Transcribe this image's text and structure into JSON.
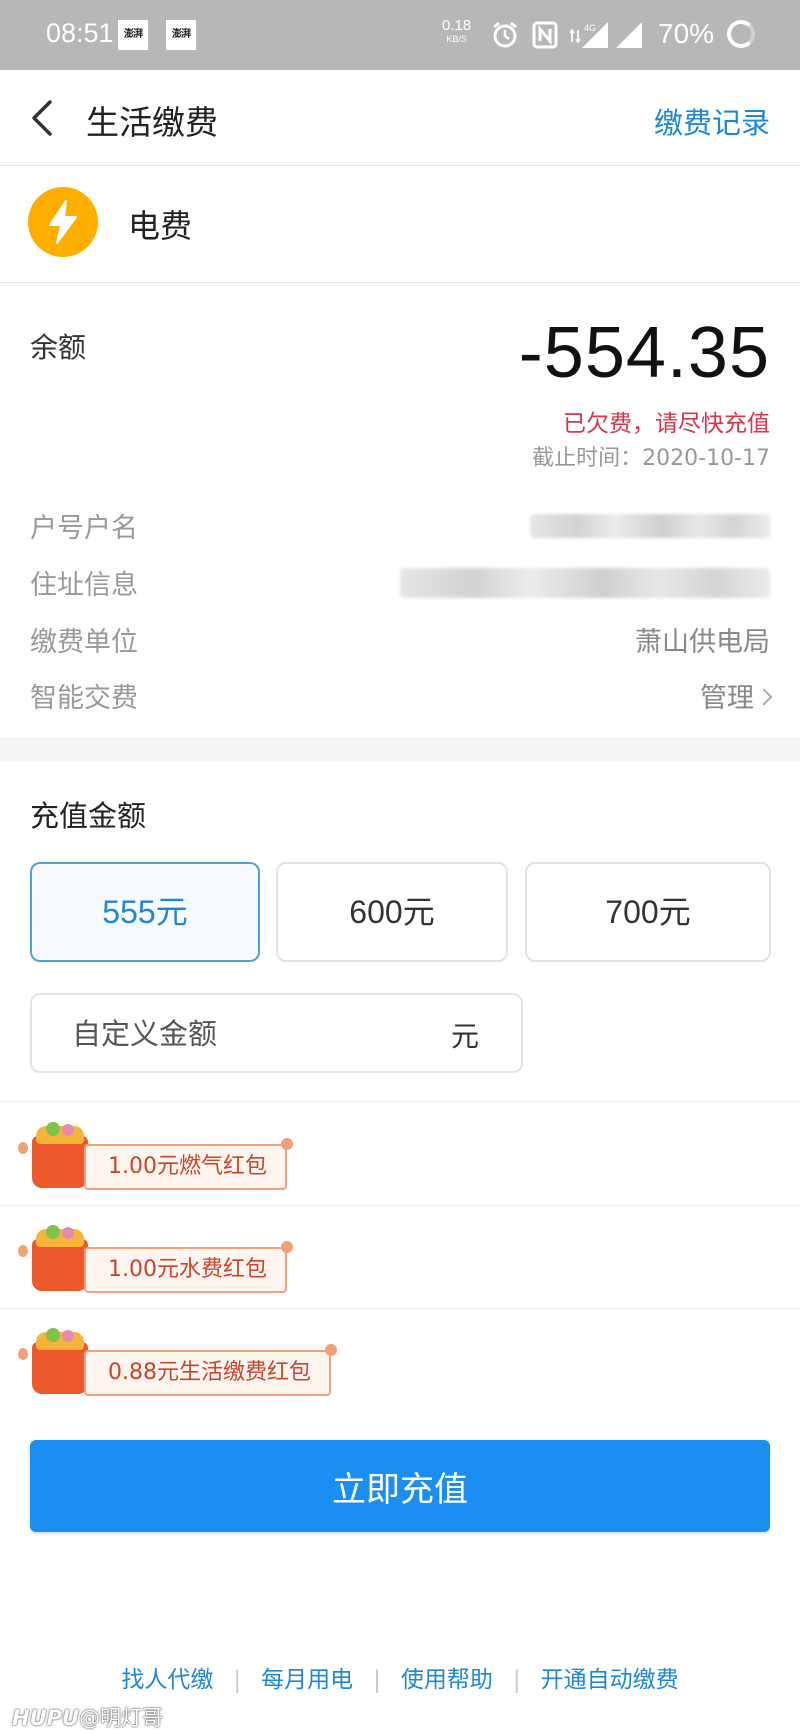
{
  "status_bar": {
    "time": "08:51",
    "app_icon_1": "澎湃",
    "app_icon_2": "澎湃",
    "net_speed": "0.18",
    "net_unit": "KB/S",
    "signal_tag": "4G",
    "battery": "70%",
    "icons": [
      "alarm-icon",
      "nfc-icon",
      "signal-4g-icon",
      "signal-icon",
      "battery-ring-icon"
    ]
  },
  "nav": {
    "title": "生活缴费",
    "record_link": "缴费记录"
  },
  "bill": {
    "icon": "lightning-icon",
    "name": "电费"
  },
  "balance": {
    "label": "余额",
    "amount": "-554.35",
    "warning": "已欠费，请尽快充值",
    "deadline": "截止时间：2020-10-17"
  },
  "info": {
    "account_label": "户号户名",
    "address_label": "住址信息",
    "company_label": "缴费单位",
    "company_value": "萧山供电局",
    "smart_label": "智能交费",
    "smart_value": "管理"
  },
  "recharge": {
    "title": "充值金额",
    "options": [
      "555元",
      "600元",
      "700元"
    ],
    "selected_index": 0,
    "custom_placeholder": "自定义金额",
    "custom_unit": "元"
  },
  "coupons": [
    "1.00元燃气红包",
    "1.00元水费红包",
    "0.88元生活缴费红包"
  ],
  "pay_button": "立即充值",
  "footer_links": [
    "找人代缴",
    "每月用电",
    "使用帮助",
    "开通自动缴费"
  ],
  "watermark": {
    "brand": "HUPU",
    "user": "@明灯哥"
  },
  "colors": {
    "accent": "#1e87d8",
    "pay_button": "#1a8ff1",
    "warning": "#d9364a",
    "bolt": "#ffae00"
  }
}
